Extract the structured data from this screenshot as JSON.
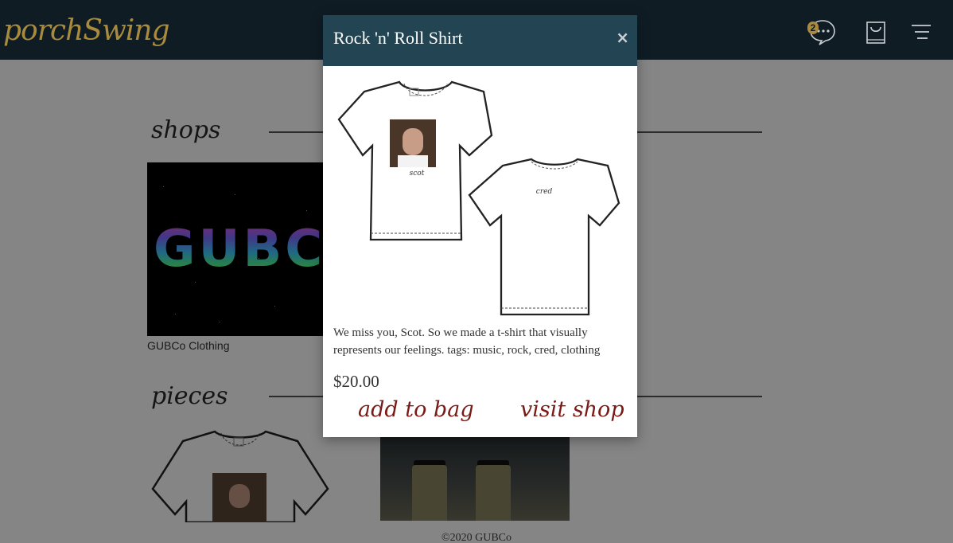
{
  "header": {
    "logo": "porchSwing",
    "chat_badge": "2",
    "icons": [
      "chat-bubble-icon",
      "shopping-bag-icon",
      "hamburger-menu-icon"
    ],
    "background": "#0f1c24",
    "logo_color": "#a88b3d"
  },
  "sections": {
    "shops_title": "shops",
    "pieces_title": "pieces"
  },
  "shops": [
    {
      "logo_text": "GUBCo",
      "caption": "GUBCo Clothing"
    }
  ],
  "footer": {
    "text": "©2020 GUBCo"
  },
  "modal": {
    "title": "Rock 'n' Roll Shirt",
    "close_label": "×",
    "front_label": "scot",
    "back_label": "cred",
    "description": "We miss you, Scot. So we made a t-shirt that visually represents our feelings. tags: music, rock, cred, clothing",
    "price": "$20.00",
    "add_to_bag": "add to bag",
    "visit_shop": "visit shop",
    "header_color": "#234553",
    "action_color": "#7a1a16"
  }
}
